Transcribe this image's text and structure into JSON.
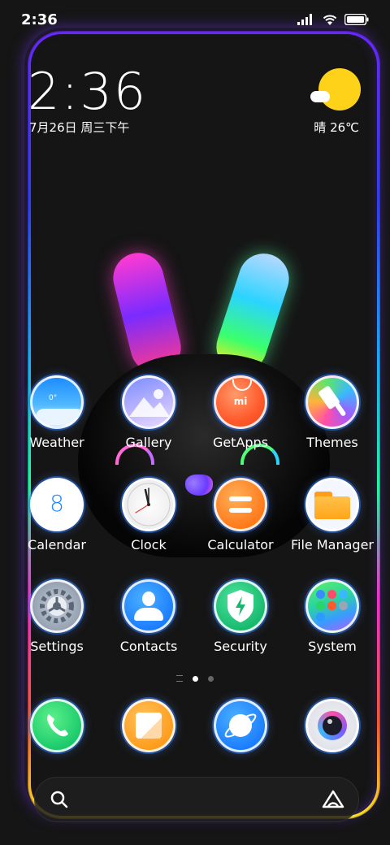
{
  "status_bar": {
    "time": "2:36"
  },
  "widget": {
    "clock": "2:36",
    "date": "7月26日 周三下午",
    "weather": "晴 26℃"
  },
  "apps": {
    "weather": "Weather",
    "gallery": "Gallery",
    "getapps": "GetApps",
    "themes": "Themes",
    "calendar": "Calendar",
    "calendar_day": "8",
    "clock": "Clock",
    "calculator": "Calculator",
    "file_manager": "File Manager",
    "settings": "Settings",
    "contacts": "Contacts",
    "security": "Security",
    "system": "System"
  },
  "getapps_logo_text": "mi",
  "weather_icon_text": "0°",
  "page_indicator": {
    "pages": 2,
    "current": 1
  }
}
